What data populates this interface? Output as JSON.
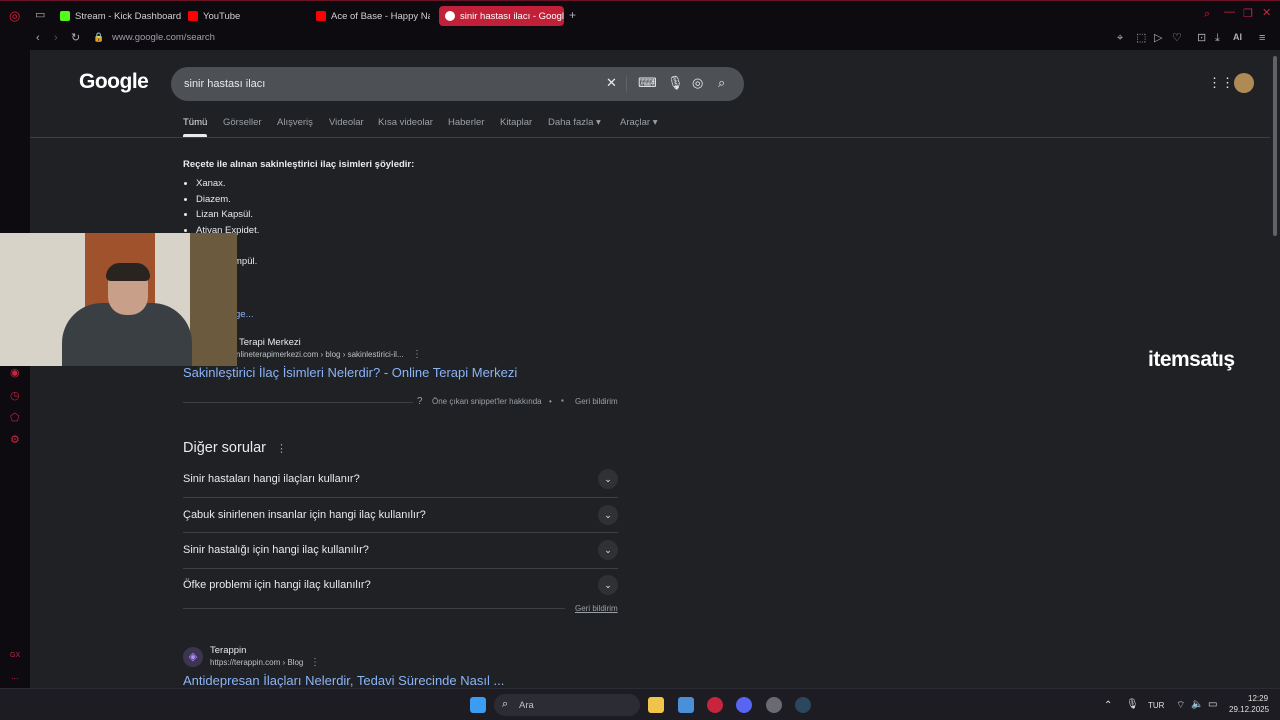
{
  "browser": {
    "tabs": [
      {
        "label": "Stream - Kick Dashboard",
        "color": "#53fc18"
      },
      {
        "label": "YouTube",
        "color": "#ff0000"
      },
      {
        "label": "Ace of Base - Happy Natio",
        "color": "#ff0000"
      },
      {
        "label": "sinir hastası ilacı - Google",
        "color": "#ffffff"
      }
    ],
    "new_tab": "+",
    "url": "www.google.com/search",
    "ai_label": "AI"
  },
  "google": {
    "logo": "Google",
    "query": "sinir hastası ilacı",
    "nav": [
      "Tümü",
      "Görseller",
      "Alışveriş",
      "Videolar",
      "Kısa videolar",
      "Haberler",
      "Kitaplar",
      "Daha fazla ▾",
      "Araçlar ▾"
    ]
  },
  "snippet": {
    "title": "Reçete ile alınan sakinleştirici ilaç isimleri şöyledir:",
    "items": [
      "Xanax.",
      "Diazem.",
      "Lizan Kapsül.",
      "Ativan Expidet.",
      "",
      "mpül."
    ],
    "more": "ge...",
    "source_name": "Terapi Merkezi",
    "source_url": "nlineterapimerkezi.com › blog › sakinlestirici-il...",
    "link": "Sakinleştirici İlaç İsimleri Nelerdir? - Online Terapi Merkezi",
    "about": "Öne çıkan snippet'ler hakkında",
    "dot": "•",
    "feedback": "Geri bildirim"
  },
  "paa": {
    "title": "Diğer sorular",
    "questions": [
      "Sinir hastaları hangi ilaçları kullanır?",
      "Çabuk sinirlenen insanlar için hangi ilaç kullanılır?",
      "Sinir hastalığı için hangi ilaç kullanılır?",
      "Öfke problemi için hangi ilaç kullanılır?"
    ],
    "feedback": "Geri bildirim"
  },
  "result2": {
    "source_name": "Terappin",
    "source_url": "https://terappin.com › Blog",
    "link": "Antidepresan İlaçları Nelerdir, Tedavi Sürecinde Nasıl ..."
  },
  "overlay": {
    "brand": "itemsatış"
  },
  "sidebar_bottom": {
    "gx": "GX",
    "more": "..."
  },
  "taskbar": {
    "search_label": "Ara",
    "lang": "TUR",
    "time": "12:29",
    "date": "29.12.2025"
  }
}
